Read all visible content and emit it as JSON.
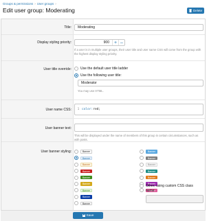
{
  "breadcrumb": {
    "items": [
      "Groups & permissions",
      "User groups"
    ],
    "sep": "›"
  },
  "page_title": "Edit user group: Moderating",
  "header": {
    "delete_label": "Delete",
    "delete_icon": "trash-icon"
  },
  "form": {
    "title": {
      "label": "Title:",
      "value": "Moderating"
    },
    "display_priority": {
      "label": "Display styling priority:",
      "value": "900",
      "plus": "+",
      "minus": "–",
      "hint": "If a user is in multiple user groups, their user title and user name CSS will come from the group with the highest display styling priority."
    },
    "user_title_override": {
      "label": "User title override:",
      "option_default": "Use the default user title ladder",
      "option_custom": "Use the following user title:",
      "selected": "custom",
      "value": "Moderator",
      "hint": "You may use HTML."
    },
    "user_name_css": {
      "label": "User name CSS:",
      "line_number": "1",
      "code_prop": "color:",
      "code_val": " red;"
    },
    "user_banner_text": {
      "label": "User banner text:",
      "value": "",
      "hint": "This will be displayed under the name of members of this group in certain circumstances, such as with posts."
    },
    "user_banner_styling": {
      "label": "User banner styling:",
      "left": [
        {
          "text": "Banner",
          "bg": "#ffffff",
          "fg": "#141414",
          "border": "#cccccc",
          "selected": false
        },
        {
          "text": "Banner",
          "bg": "#e6f0fa",
          "fg": "#2577b1",
          "border": "#bcd3ea",
          "selected": true
        },
        {
          "text": "Banner",
          "bg": "#fdf6e3",
          "fg": "#c26d1a",
          "border": "#ecd9a6",
          "selected": false
        },
        {
          "text": "Banner",
          "bg": "#c9201f",
          "fg": "#ffffff",
          "border": "#c9201f",
          "selected": false
        },
        {
          "text": "Banner",
          "bg": "#3e8c1c",
          "fg": "#ffffff",
          "border": "#3e8c1c",
          "selected": false
        },
        {
          "text": "Banner",
          "bg": "#d4a91c",
          "fg": "#ffffff",
          "border": "#d4a91c",
          "selected": false
        },
        {
          "text": "Banner",
          "bg": "#e9f5e1",
          "fg": "#3e8c1c",
          "border": "#c2e2ad",
          "selected": false
        },
        {
          "text": "Banner",
          "bg": "#0b3ea6",
          "fg": "#ffffff",
          "border": "#0b3ea6",
          "selected": false
        },
        {
          "text": "Banner",
          "bg": "#ffffff",
          "fg": "#141414",
          "border": "#cccccc",
          "selected": false
        }
      ],
      "right": [
        {
          "text": "Banner",
          "bg": "#5aa8e0",
          "fg": "#ffffff",
          "border": "#5aa8e0",
          "selected": false
        },
        {
          "text": "Banner",
          "bg": "#7f7f7f",
          "fg": "#ffffff",
          "border": "#7f7f7f",
          "selected": false
        },
        {
          "text": "Banner",
          "bg": "#f5f5f5",
          "fg": "#8c8c8c",
          "border": "#dcdcdc",
          "selected": false
        },
        {
          "text": "Banner",
          "bg": "#1f8f88",
          "fg": "#ffffff",
          "border": "#1f8f88",
          "selected": false
        },
        {
          "text": "Banner",
          "bg": "#e07a1a",
          "fg": "#ffffff",
          "border": "#e07a1a",
          "selected": false
        },
        {
          "text": "Banner",
          "bg": "#9f2db0",
          "fg": "#ffffff",
          "border": "#9f2db0",
          "selected": false
        },
        {
          "text": "Banner",
          "bg": "#e05a9a",
          "fg": "#ffffff",
          "border": "#e05a9a",
          "selected": false
        }
      ],
      "other_label_line1": "Other, using custom CSS class",
      "other_label_line2": "name",
      "other_value": ""
    }
  },
  "footer": {
    "save_label": "Save",
    "save_icon": "save-icon"
  },
  "colors": {
    "accent": "#2577b1",
    "muted": "#8c8c8c"
  }
}
